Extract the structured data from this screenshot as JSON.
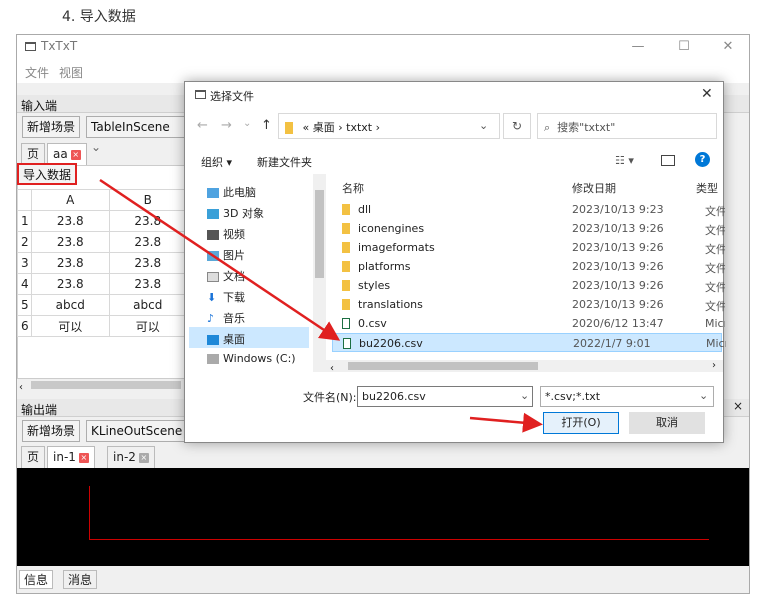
{
  "heading": "4. 导入数据",
  "main_window": {
    "title": "TxTxT",
    "menu": [
      "文件",
      "视图"
    ],
    "input_section": {
      "header": "输入端",
      "add_scene_button": "新增场景",
      "scene_select": "TableInScene",
      "tabs": [
        "页",
        "aa"
      ],
      "import_button": "导入数据",
      "columns": [
        "A",
        "B"
      ],
      "rows": [
        {
          "num": "1",
          "a": "23.8",
          "b": "23.8"
        },
        {
          "num": "2",
          "a": "23.8",
          "b": "23.8"
        },
        {
          "num": "3",
          "a": "23.8",
          "b": "23.8"
        },
        {
          "num": "4",
          "a": "23.8",
          "b": "23.8"
        },
        {
          "num": "5",
          "a": "abcd",
          "b": "abcd"
        },
        {
          "num": "6",
          "a": "可以",
          "b": "可以"
        }
      ]
    },
    "output_section": {
      "header": "输出端",
      "add_scene_button": "新增场景",
      "scene_select": "KLineOutScene",
      "tabs": [
        "页",
        "in-1",
        "in-2"
      ]
    },
    "status_tabs": [
      "信息",
      "消息"
    ]
  },
  "dialog": {
    "title": "选择文件",
    "breadcrumb": [
      "«",
      "桌面",
      "›",
      "txtxt",
      "›"
    ],
    "search_placeholder": "搜索\"txtxt\"",
    "organize": "组织 ▾",
    "new_folder": "新建文件夹",
    "nav_items": [
      "此电脑",
      "3D 对象",
      "视频",
      "图片",
      "文档",
      "下载",
      "音乐",
      "桌面",
      "Windows (C:)"
    ],
    "columns": {
      "name": "名称",
      "date": "修改日期",
      "type": "类型"
    },
    "files": [
      {
        "name": "dll",
        "date": "2023/10/13 9:23",
        "type": "文件夹",
        "kind": "folder"
      },
      {
        "name": "iconengines",
        "date": "2023/10/13 9:26",
        "type": "文件夹",
        "kind": "folder"
      },
      {
        "name": "imageformats",
        "date": "2023/10/13 9:26",
        "type": "文件夹",
        "kind": "folder"
      },
      {
        "name": "platforms",
        "date": "2023/10/13 9:26",
        "type": "文件夹",
        "kind": "folder"
      },
      {
        "name": "styles",
        "date": "2023/10/13 9:26",
        "type": "文件夹",
        "kind": "folder"
      },
      {
        "name": "translations",
        "date": "2023/10/13 9:26",
        "type": "文件夹",
        "kind": "folder"
      },
      {
        "name": "0.csv",
        "date": "2020/6/12 13:47",
        "type": "Microsoft",
        "kind": "csv"
      },
      {
        "name": "bu2206.csv",
        "date": "2022/1/7 9:01",
        "type": "Microsoft",
        "kind": "csv"
      }
    ],
    "filename_label": "文件名(N):",
    "filename_value": "bu2206.csv",
    "filetype": "*.csv;*.txt",
    "open_button": "打开(O)",
    "cancel_button": "取消"
  },
  "colors": {
    "highlight_red": "#e02020",
    "selection": "#cce8ff",
    "accent": "#0078d7"
  }
}
